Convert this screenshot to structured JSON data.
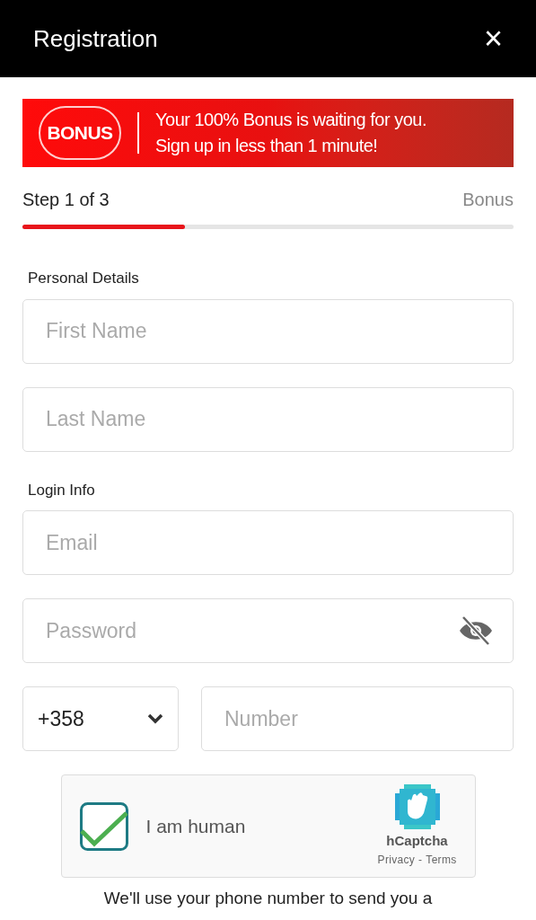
{
  "header": {
    "title": "Registration",
    "close": "×"
  },
  "banner": {
    "logo": "BONUS",
    "line_1": "Your 100% Bonus is waiting for you.",
    "line_2": "Sign up in less than 1 minute!"
  },
  "progress": {
    "step": "Step 1 of 3",
    "next": "Bonus",
    "level": 0.33
  },
  "sections": [
    {
      "title": "Personal Details",
      "fields": [
        {
          "placeholder": "First Name",
          "kind": "text"
        },
        {
          "placeholder": "Last Name",
          "kind": "text"
        }
      ]
    },
    {
      "title": "Login Info",
      "fields": [
        {
          "placeholder": "Email",
          "kind": "text"
        },
        {
          "placeholder": "Password",
          "kind": "password"
        }
      ]
    }
  ],
  "phone": {
    "code": "+358",
    "placeholder": "Number"
  },
  "captcha": {
    "label": "I am human",
    "checked": true,
    "brand": "hCaptcha",
    "links": [
      "Privacy",
      "Terms"
    ],
    "separator": "-"
  },
  "notice": "We'll use your phone number to send you a"
}
